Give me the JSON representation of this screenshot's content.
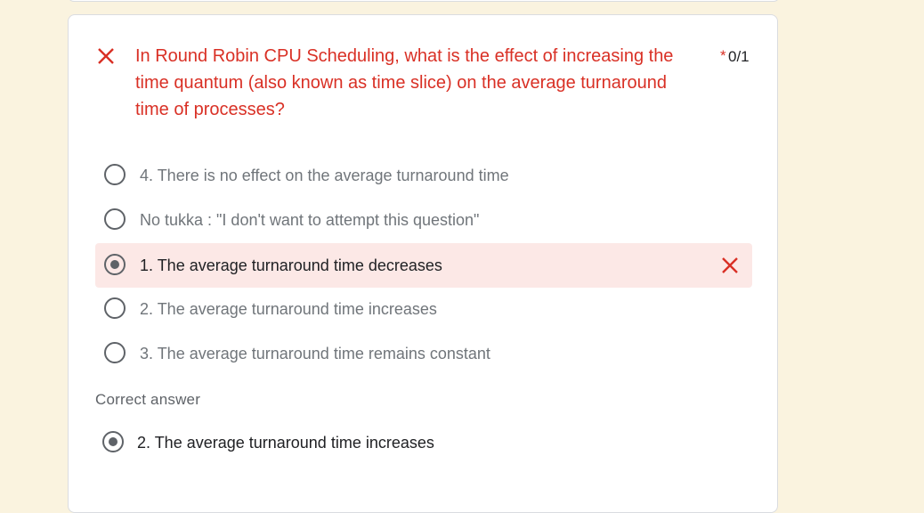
{
  "question": {
    "text": "In Round Robin CPU Scheduling, what is the effect of increasing the time quantum (also known as time slice) on the average turnaround time of processes?",
    "required_marker": "*",
    "score": "0/1",
    "status_icon": "close-icon",
    "status_color": "#d93025"
  },
  "options": [
    {
      "label": "4. There is no effect on the average turnaround time",
      "selected": false,
      "incorrect": false
    },
    {
      "label": "No tukka : \"I don't want to attempt this question\"",
      "selected": false,
      "incorrect": false
    },
    {
      "label": "1. The average turnaround time decreases",
      "selected": true,
      "incorrect": true
    },
    {
      "label": "2. The average turnaround time increases",
      "selected": false,
      "incorrect": false
    },
    {
      "label": "3. The average turnaround time remains constant",
      "selected": false,
      "incorrect": false
    }
  ],
  "correct_answer": {
    "heading": "Correct answer",
    "label": "2. The average turnaround time increases"
  },
  "colors": {
    "page_background": "#faf3df",
    "error": "#d93025",
    "wrong_highlight": "#fce8e6"
  }
}
